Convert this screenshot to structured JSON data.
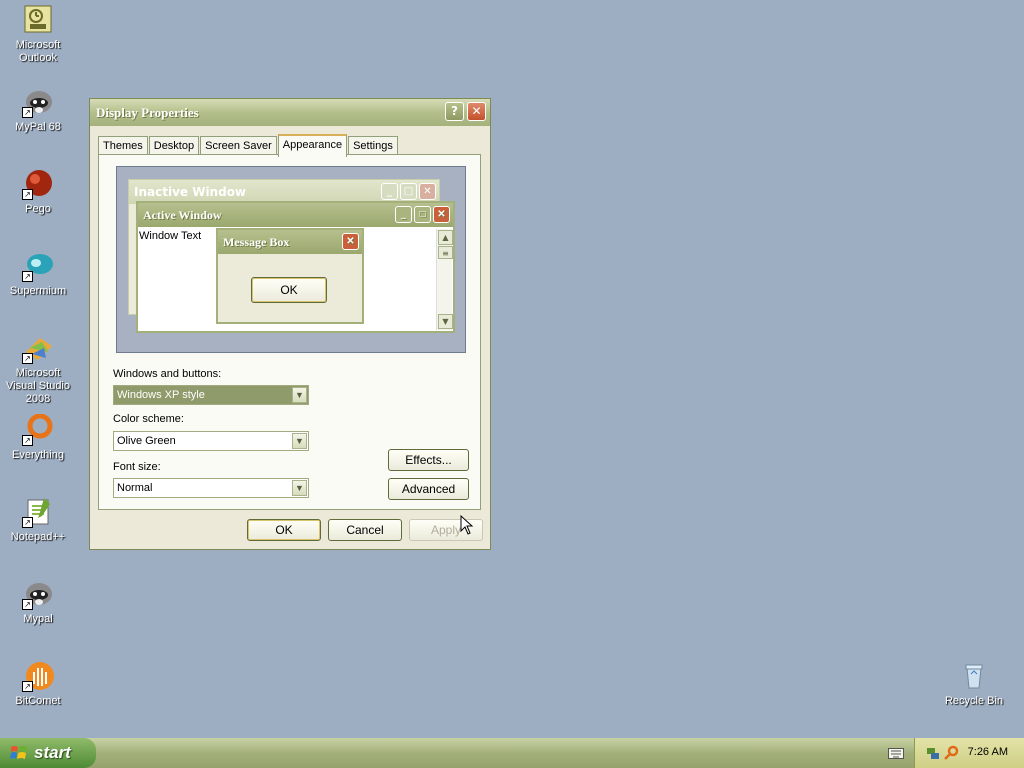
{
  "desktop": {
    "icons": [
      {
        "label": "Microsoft Outlook",
        "name": "outlook-icon"
      },
      {
        "label": "MyPal 68",
        "name": "mypal68-icon"
      },
      {
        "label": "Pego",
        "name": "pego-icon"
      },
      {
        "label": "Supermium",
        "name": "supermium-icon"
      },
      {
        "label": "Microsoft Visual Studio 2008",
        "name": "visual-studio-icon"
      },
      {
        "label": "Everything",
        "name": "everything-icon"
      },
      {
        "label": "Notepad++",
        "name": "notepadpp-icon"
      },
      {
        "label": "Mypal",
        "name": "mypal-icon"
      },
      {
        "label": "BitComet",
        "name": "bitcomet-icon"
      }
    ],
    "recycle_bin": "Recycle Bin"
  },
  "window": {
    "title": "Display Properties",
    "help": "?",
    "close": "✕",
    "tabs": [
      "Themes",
      "Desktop",
      "Screen Saver",
      "Appearance",
      "Settings"
    ],
    "active_tab": "Appearance",
    "preview": {
      "inactive_title": "Inactive Window",
      "active_title": "Active Window",
      "window_text": "Window Text",
      "message_box_title": "Message Box",
      "ok": "OK"
    },
    "windows_buttons_label": "Windows and buttons:",
    "windows_buttons_value": "Windows XP style",
    "color_scheme_label": "Color scheme:",
    "color_scheme_value": "Olive Green",
    "font_size_label": "Font size:",
    "font_size_value": "Normal",
    "effects_button": "Effects...",
    "advanced_button": "Advanced",
    "ok_button": "OK",
    "cancel_button": "Cancel",
    "apply_button": "Apply"
  },
  "taskbar": {
    "start_label": "start",
    "clock": "7:26 AM"
  },
  "colors": {
    "desktop_bg": "#9eaec2",
    "title_olive": "#a6b27c",
    "taskbar": "#a3b07a"
  }
}
